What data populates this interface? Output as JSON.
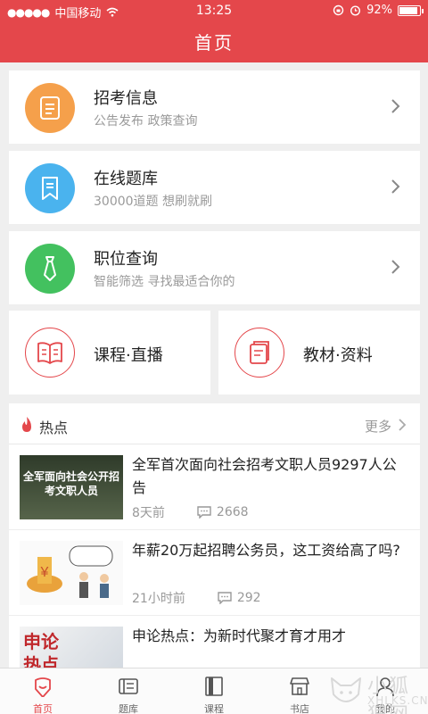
{
  "status_bar": {
    "carrier": "中国移动",
    "time": "13:25",
    "battery": "92%",
    "battery_level": 0.92
  },
  "header": {
    "title": "首页"
  },
  "menu": [
    {
      "title": "招考信息",
      "subtitle": "公告发布 政策查询",
      "icon": "document-icon",
      "color": "#f5a04b"
    },
    {
      "title": "在线题库",
      "subtitle": "30000道题 想刷就刷",
      "icon": "bookmark-icon",
      "color": "#4ab3ee"
    },
    {
      "title": "职位查询",
      "subtitle": "智能筛选 寻找最适合你的",
      "icon": "tie-icon",
      "color": "#43c15f"
    }
  ],
  "quick": [
    {
      "label": "课程·直播",
      "icon": "open-book-icon"
    },
    {
      "label": "教材·资料",
      "icon": "notes-icon"
    }
  ],
  "hot": {
    "title": "热点",
    "more": "更多",
    "items": [
      {
        "title": "全军首次面向社会招考文职人员9297人公告",
        "time": "8天前",
        "comments": "2668",
        "thumb_text": "全军面向社会公开招考文职人员"
      },
      {
        "title": "年薪20万起招聘公务员，这工资给高了吗?",
        "time": "21小时前",
        "comments": "292",
        "thumb_text": ""
      },
      {
        "title": "申论热点：为新时代聚才育才用才",
        "time": "",
        "comments": "",
        "thumb_text": "申论热点"
      }
    ]
  },
  "tabs": [
    {
      "label": "首页",
      "icon": "home-icon",
      "active": true
    },
    {
      "label": "题库",
      "icon": "quiz-icon",
      "active": false
    },
    {
      "label": "课程",
      "icon": "course-icon",
      "active": false
    },
    {
      "label": "书店",
      "icon": "store-icon",
      "active": false
    },
    {
      "label": "我的",
      "icon": "profile-icon",
      "active": false
    }
  ],
  "watermark": {
    "line1": "小狐狸网",
    "line2": "XHLKS.CN"
  }
}
